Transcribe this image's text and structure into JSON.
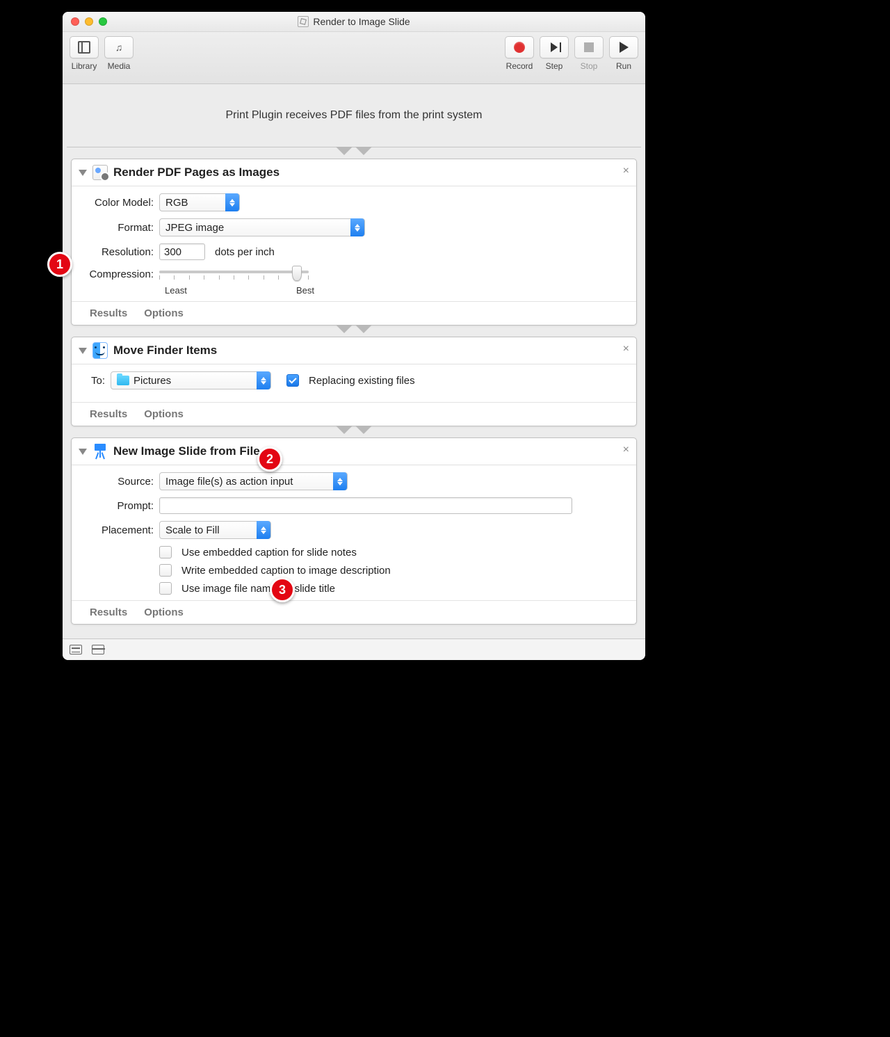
{
  "window": {
    "title": "Render to Image Slide"
  },
  "toolbar": {
    "library": "Library",
    "media": "Media",
    "record": "Record",
    "step": "Step",
    "stop": "Stop",
    "run": "Run"
  },
  "banner": "Print Plugin receives PDF files from the print system",
  "action1": {
    "title": "Render PDF Pages as Images",
    "color_model_label": "Color Model:",
    "color_model_value": "RGB",
    "format_label": "Format:",
    "format_value": "JPEG image",
    "resolution_label": "Resolution:",
    "resolution_value": "300",
    "resolution_suffix": "dots per inch",
    "compression_label": "Compression:",
    "slider_least": "Least",
    "slider_best": "Best",
    "slider_position_percent": 95
  },
  "action2": {
    "title": "Move Finder Items",
    "to_label": "To:",
    "destination": "Pictures",
    "replace_checked": true,
    "replace_label": "Replacing existing files"
  },
  "action3": {
    "title": "New Image Slide from File",
    "source_label": "Source:",
    "source_value": "Image file(s) as action input",
    "prompt_label": "Prompt:",
    "prompt_value": "",
    "placement_label": "Placement:",
    "placement_value": "Scale to Fill",
    "opt1_checked": false,
    "opt1_label": "Use embedded caption for slide notes",
    "opt2_checked": false,
    "opt2_label": "Write embedded caption to image description",
    "opt3_checked": false,
    "opt3_label": "Use image file name for slide title"
  },
  "footer": {
    "results": "Results",
    "options": "Options"
  },
  "annotations": {
    "b1": "1",
    "b2": "2",
    "b3": "3"
  }
}
